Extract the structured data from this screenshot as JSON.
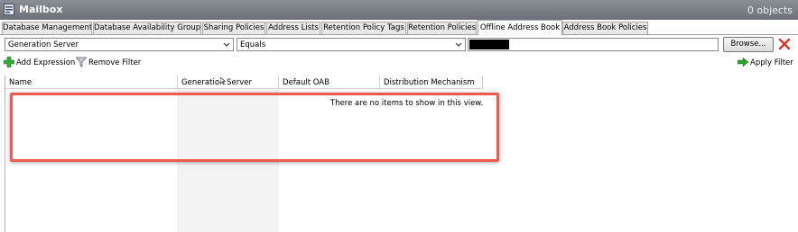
{
  "window": {
    "title": "Mailbox",
    "object_count": "0 objects",
    "icon": "mailbox-icon"
  },
  "tabs": [
    {
      "label": "Database Management"
    },
    {
      "label": "Database Availability Groups"
    },
    {
      "label": "Sharing Policies"
    },
    {
      "label": "Address Lists"
    },
    {
      "label": "Retention Policy Tags"
    },
    {
      "label": "Retention Policies"
    },
    {
      "label": "Offline Address Book",
      "active": true
    },
    {
      "label": "Address Book Policies"
    }
  ],
  "filter": {
    "attribute": "Generation Server",
    "operator": "Equals",
    "value": "",
    "browse_label": "Browse...",
    "add_expression_label": "Add Expression",
    "remove_filter_label": "Remove Filter",
    "apply_filter_label": "Apply Filter"
  },
  "grid": {
    "columns": [
      "Name",
      "Generation Server",
      "Default OAB",
      "Distribution Mechanism"
    ],
    "empty_message": "There are no items to show in this view."
  },
  "colors": {
    "highlight": "#ee5a4f",
    "apply_arrow": "#2fa02f",
    "delete_x": "#d9342b"
  }
}
